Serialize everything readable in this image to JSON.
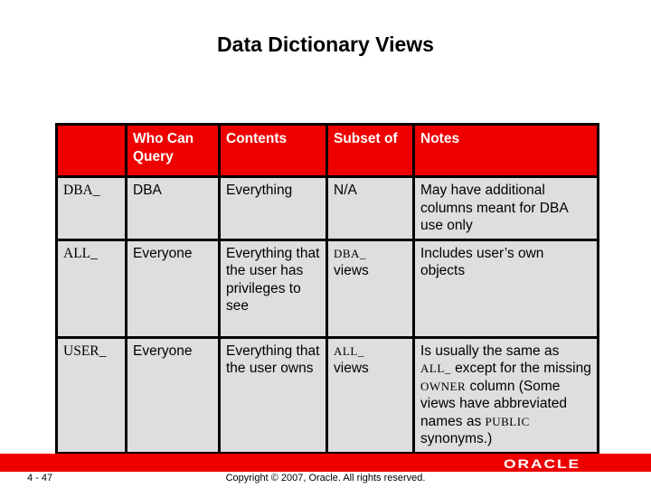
{
  "title": "Data Dictionary Views",
  "table": {
    "headers": [
      "",
      "Who Can Query",
      "Contents",
      "Subset of",
      "Notes"
    ],
    "rows": [
      {
        "prefix": "DBA_",
        "who": "DBA",
        "contents": "Everything",
        "subset_code": "",
        "subset_text": "N/A",
        "notes": "May have additional columns meant for DBA use only"
      },
      {
        "prefix": "ALL_",
        "who": "Everyone",
        "contents": "Everything that the user has privileges to see",
        "subset_code": "DBA_",
        "subset_text": "views",
        "notes": "Includes user’s own objects"
      },
      {
        "prefix": "USER_",
        "who": "Everyone",
        "contents": "Everything that the user owns",
        "subset_code": "ALL_",
        "subset_text": "views",
        "notes_parts": {
          "t1": "Is usually the same as ",
          "c1": "ALL_",
          "t2": " except for the missing ",
          "c2": "OWNER",
          "t3": " column (Some views have abbreviated names as ",
          "c3": "PUBLIC",
          "t4": " synonyms.)"
        }
      }
    ]
  },
  "footer": {
    "page": "4 - 47",
    "copyright": "Copyright © 2007, Oracle. All rights reserved.",
    "logo": "ORACLE",
    "accent_color": "#ee0000"
  }
}
